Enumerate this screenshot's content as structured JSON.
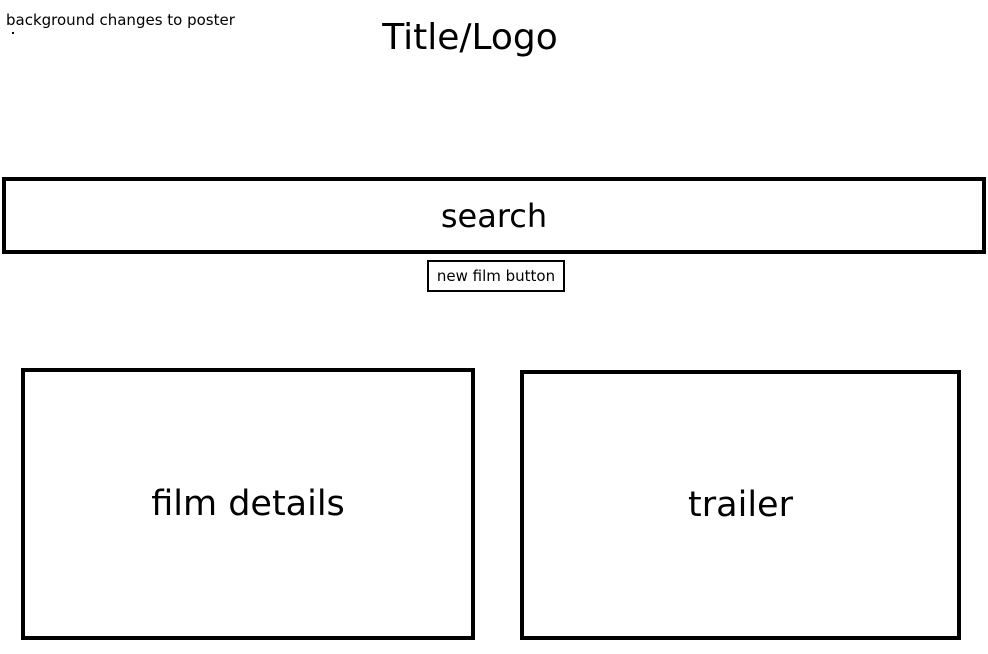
{
  "note": "background changes to poster",
  "title": "Title/Logo",
  "search": {
    "label": "search"
  },
  "new_film_button": {
    "label": "new film button"
  },
  "panels": {
    "film_details": "film details",
    "trailer": "trailer"
  }
}
